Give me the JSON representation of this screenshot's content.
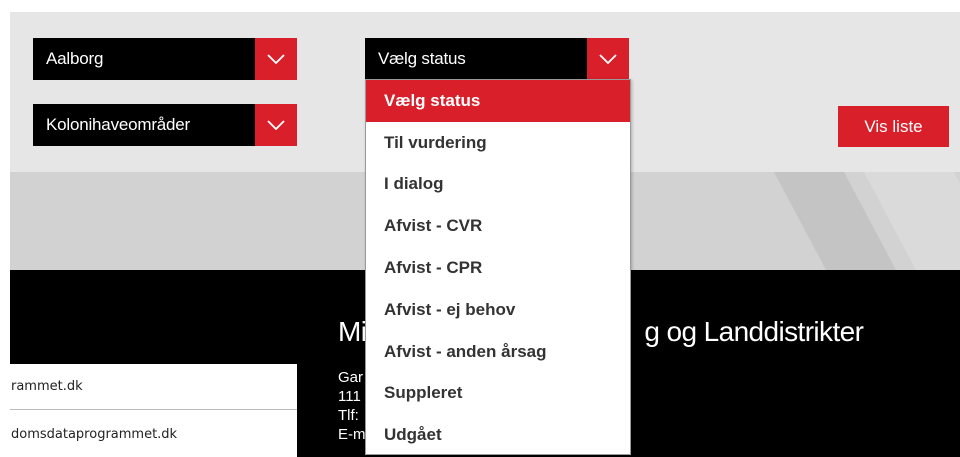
{
  "filters": {
    "city_select": {
      "value": "Aalborg"
    },
    "type_select": {
      "value": "Kolonihaveområder"
    },
    "status_select": {
      "value": "Vælg status"
    }
  },
  "status_dropdown": {
    "options": [
      {
        "label": "Vælg status"
      },
      {
        "label": "Til vurdering"
      },
      {
        "label": "I dialog"
      },
      {
        "label": "Afvist - CVR"
      },
      {
        "label": "Afvist - CPR"
      },
      {
        "label": "Afvist - ej behov"
      },
      {
        "label": "Afvist - anden årsag"
      },
      {
        "label": "Suppleret"
      },
      {
        "label": "Udgået"
      }
    ],
    "selected_index": 0
  },
  "actions": {
    "vis_liste_label": "Vis liste"
  },
  "footer": {
    "title_visible_start": "Mi",
    "title_visible_end": "g og Landdistrikter",
    "address_lines": [
      "Gar",
      "111",
      "Tlf:",
      "E-mail:"
    ],
    "links": [
      {
        "label": "rammet.dk"
      },
      {
        "label": "domsdataprogrammet.dk"
      }
    ]
  },
  "colors": {
    "accent_red": "#d91f2a",
    "select_bg": "#000000",
    "panel_bg": "#e6e6e6",
    "footer_bg": "#000000"
  },
  "icons": {
    "select_arrow": "chevron-down-icon"
  }
}
